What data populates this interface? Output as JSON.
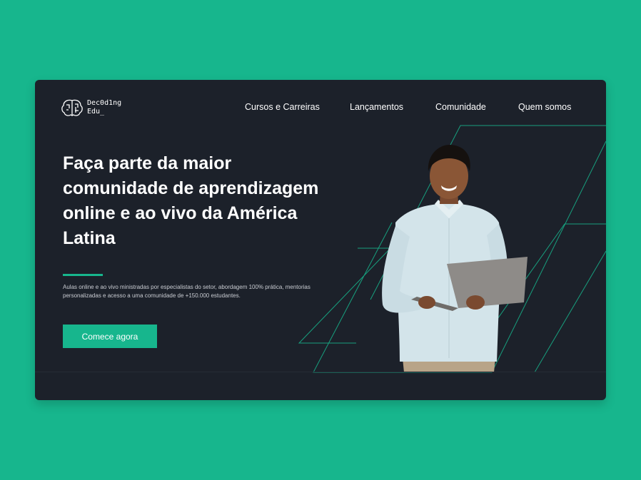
{
  "logo": {
    "line1": "Dec0d1ng",
    "line2": "Edu_"
  },
  "nav": {
    "items": [
      "Cursos e Carreiras",
      "Lançamentos",
      "Comunidade",
      "Quem somos"
    ]
  },
  "hero": {
    "headline": "Faça parte da maior comunidade de aprendizagem online e ao vivo da América Latina",
    "subtext": "Aulas online e ao vivo ministradas por especialistas do setor, abordagem 100% prática, mentorias personalizadas e acesso a uma comunidade de +150.000 estudantes.",
    "cta_label": "Comece agora"
  },
  "colors": {
    "background": "#17b68d",
    "card": "#1c212a",
    "accent": "#17b68d",
    "text": "#ffffff"
  },
  "icons": {
    "logo": "brain-icon",
    "hero_image": "person-with-laptop"
  }
}
